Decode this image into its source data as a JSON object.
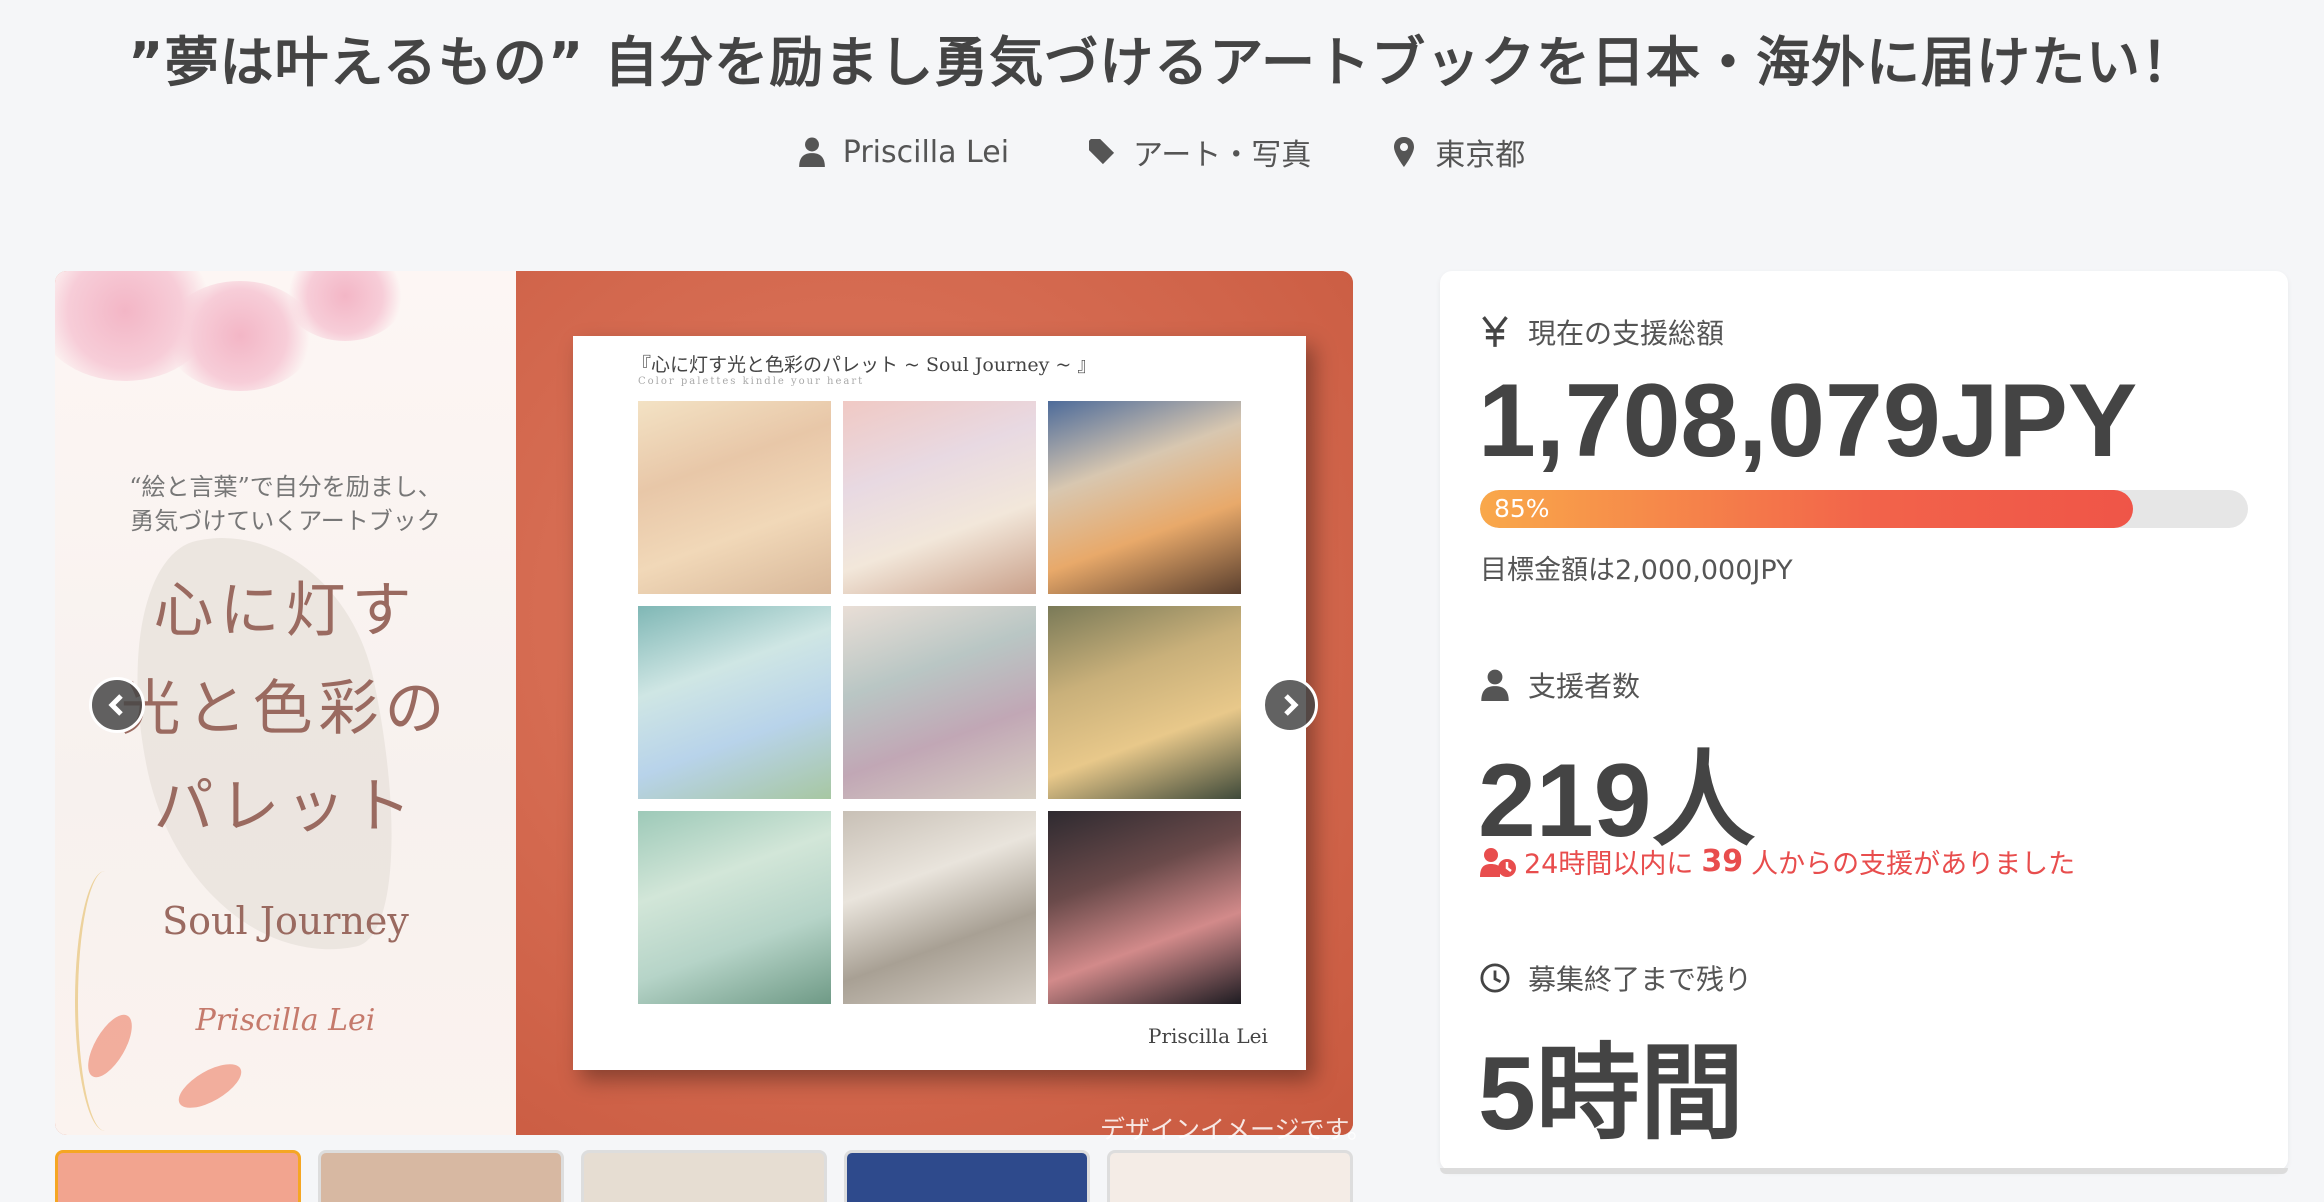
{
  "project": {
    "title": "”夢は叶えるもの” 自分を励まし勇気づけるアートブックを日本・海外に届けたい！",
    "author": "Priscilla Lei",
    "category": "アート・写真",
    "location": "東京都"
  },
  "hero": {
    "cover_subtitle_line1": "“絵と言葉”で自分を励まし、",
    "cover_subtitle_line2": "勇気づけていくアートブック",
    "cover_title_line1": "心に灯す",
    "cover_title_line2": "光と色彩の",
    "cover_title_line3": "パレット",
    "cover_english": "Soul Journey",
    "cover_signature": "Priscilla Lei",
    "book_title": "『心に灯す光と色彩のパレット ~ Soul Journey ~ 』",
    "book_subtitle": "Color palettes kindle your heart",
    "book_author": "Priscilla Lei",
    "watermark": "デザインイメージです。",
    "tiles": [
      {
        "colors": [
          "#f3e2c4",
          "#e8c7a8",
          "#f1d8b8",
          "#d8b89a"
        ]
      },
      {
        "colors": [
          "#f0c9c4",
          "#e8d9e2",
          "#f2e7da",
          "#c9a08a"
        ]
      },
      {
        "colors": [
          "#4d6b9a",
          "#d8c7b0",
          "#e8a96a",
          "#5a3f2e"
        ]
      },
      {
        "colors": [
          "#7fb7b5",
          "#cfe6e4",
          "#b8d3ea",
          "#a7c7a2"
        ]
      },
      {
        "colors": [
          "#e9ded6",
          "#b9c6c4",
          "#c1a7b5",
          "#d8d0c4"
        ]
      },
      {
        "colors": [
          "#7a7a58",
          "#c9b07a",
          "#e8c88a",
          "#3f4a3a"
        ]
      },
      {
        "colors": [
          "#9dc9b8",
          "#d2e6d8",
          "#b6d4c8",
          "#6f9a86"
        ]
      },
      {
        "colors": [
          "#c8c0b6",
          "#e9e4dc",
          "#a8a094",
          "#d6cfc6"
        ]
      },
      {
        "colors": [
          "#2e2a30",
          "#6a4a4a",
          "#d28a8a",
          "#1e1c22"
        ]
      }
    ]
  },
  "thumbnails": [
    {
      "name": "thumb-1",
      "bg": "#f2a48f",
      "active": true
    },
    {
      "name": "thumb-2",
      "bg": "#d7b8a2",
      "active": false
    },
    {
      "name": "thumb-3",
      "bg": "#e6ddd2",
      "active": false
    },
    {
      "name": "thumb-4",
      "bg": "#2e4a8c",
      "active": false
    },
    {
      "name": "thumb-5",
      "bg": "#f4ece6",
      "active": false
    }
  ],
  "stats": {
    "total_label": "現在の支援総額",
    "total_value": "1,708,079JPY",
    "progress_percent": 85,
    "progress_text": "85%",
    "goal_text": "目標金額は2,000,000JPY",
    "backers_label": "支援者数",
    "backers_value": "219人",
    "recent_prefix": "24時間以内に",
    "recent_count": "39",
    "recent_suffix": "人からの支援がありました",
    "remaining_label": "募集終了まで残り",
    "remaining_value": "5時間"
  },
  "colors": {
    "accent_red": "#e84d4d",
    "progress_start": "#f9a84a",
    "progress_end": "#ef5548",
    "text_dark": "#444444"
  },
  "icons": {
    "author": "user-icon",
    "category": "tag-icon",
    "location": "pin-icon",
    "yen": "yen-icon",
    "backers": "user-icon",
    "recent": "user-clock-icon",
    "time": "clock-icon",
    "prev": "chevron-left-icon",
    "next": "chevron-right-icon"
  }
}
